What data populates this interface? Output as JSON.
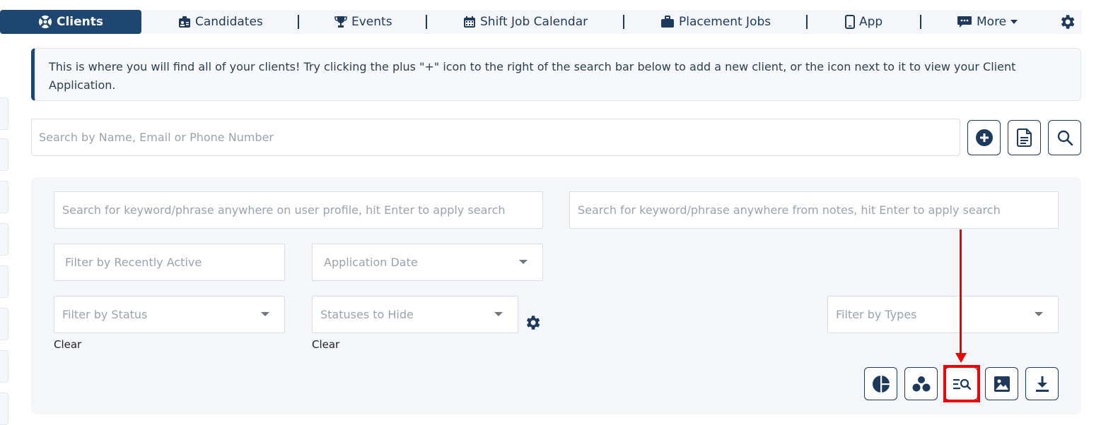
{
  "nav": {
    "tabs": [
      {
        "label": "Clients",
        "icon": "life-ring-icon",
        "active": true
      },
      {
        "label": "Candidates",
        "icon": "id-card-icon"
      },
      {
        "label": "Events",
        "icon": "trophy-icon"
      },
      {
        "label": "Shift Job Calendar",
        "icon": "calendar-icon"
      },
      {
        "label": "Placement Jobs",
        "icon": "briefcase-icon"
      },
      {
        "label": "App",
        "icon": "mobile-icon"
      },
      {
        "label": "More",
        "icon": "comment-icon"
      }
    ],
    "settings_icon": "gear-icon"
  },
  "banner": {
    "text": "This is where you will find all of your clients! Try clicking the plus \"+\" icon to the right of the search bar below to add a new client, or the icon next to it to view your Client Application."
  },
  "search": {
    "placeholder": "Search by Name, Email or Phone Number",
    "buttons": [
      "plus-circle-icon",
      "document-icon",
      "search-icon"
    ]
  },
  "filters": {
    "profile_keyword_placeholder": "Search for keyword/phrase anywhere on user profile, hit Enter to apply search",
    "notes_keyword_placeholder": "Search for keyword/phrase anywhere from notes, hit Enter to apply search",
    "recently_active_placeholder": "Filter by Recently Active",
    "application_date": "Application Date",
    "status": "Filter by Status",
    "statuses_to_hide": "Statuses to Hide",
    "types": "Filter by Types",
    "clear_label": "Clear"
  },
  "toolbar": {
    "buttons": [
      "pie-chart-icon",
      "cluster-icon",
      "list-search-icon",
      "image-icon",
      "download-icon"
    ],
    "highlighted": "list-search-icon"
  },
  "colors": {
    "brand": "#1d4770",
    "highlight": "#ee0000",
    "panel_bg": "#f4f6f9"
  }
}
